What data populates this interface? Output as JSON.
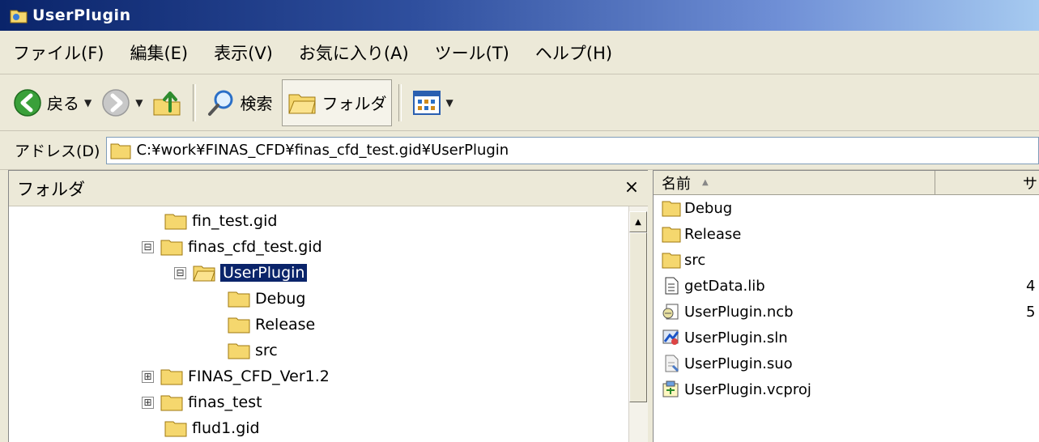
{
  "window": {
    "title": "UserPlugin"
  },
  "menu": {
    "items": [
      {
        "label": "ファイル(F)"
      },
      {
        "label": "編集(E)"
      },
      {
        "label": "表示(V)"
      },
      {
        "label": "お気に入り(A)"
      },
      {
        "label": "ツール(T)"
      },
      {
        "label": "ヘルプ(H)"
      }
    ]
  },
  "toolbar": {
    "back_label": "戻る",
    "search_label": "検索",
    "folders_label": "フォルダ"
  },
  "address": {
    "label": "アドレス(D)",
    "value": "C:¥work¥FINAS_CFD¥finas_cfd_test.gid¥UserPlugin"
  },
  "folder_pane": {
    "header": "フォルダ",
    "close_glyph": "×",
    "nodes": [
      {
        "label": "fin_test.gid",
        "expander": ""
      },
      {
        "label": "finas_cfd_test.gid",
        "expander": "⊟"
      },
      {
        "label": "UserPlugin",
        "expander": "⊟",
        "selected": true
      },
      {
        "label": "Debug",
        "expander": ""
      },
      {
        "label": "Release",
        "expander": ""
      },
      {
        "label": "src",
        "expander": ""
      },
      {
        "label": "FINAS_CFD_Ver1.2",
        "expander": "⊞"
      },
      {
        "label": "finas_test",
        "expander": "⊞"
      },
      {
        "label": "flud1.gid",
        "expander": ""
      }
    ]
  },
  "file_list": {
    "columns": [
      {
        "label": "名前",
        "sort_glyph": "▲"
      },
      {
        "label": "サ"
      }
    ],
    "files": [
      {
        "name": "Debug",
        "icon": "folder-icon",
        "size": ""
      },
      {
        "name": "Release",
        "icon": "folder-icon",
        "size": ""
      },
      {
        "name": "src",
        "icon": "folder-icon",
        "size": ""
      },
      {
        "name": "getData.lib",
        "icon": "lib-file-icon",
        "size": "4"
      },
      {
        "name": "UserPlugin.ncb",
        "icon": "ncb-file-icon",
        "size": "5"
      },
      {
        "name": "UserPlugin.sln",
        "icon": "solution-file-icon",
        "size": ""
      },
      {
        "name": "UserPlugin.suo",
        "icon": "suo-file-icon",
        "size": ""
      },
      {
        "name": "UserPlugin.vcproj",
        "icon": "vcproj-file-icon",
        "size": ""
      }
    ]
  },
  "colors": {
    "title_gradient_start": "#0a246a",
    "title_gradient_end": "#a6caf0",
    "chrome_background": "#ece9d8",
    "selection": "#0a246a",
    "folder_yellow": "#f5d76e"
  }
}
